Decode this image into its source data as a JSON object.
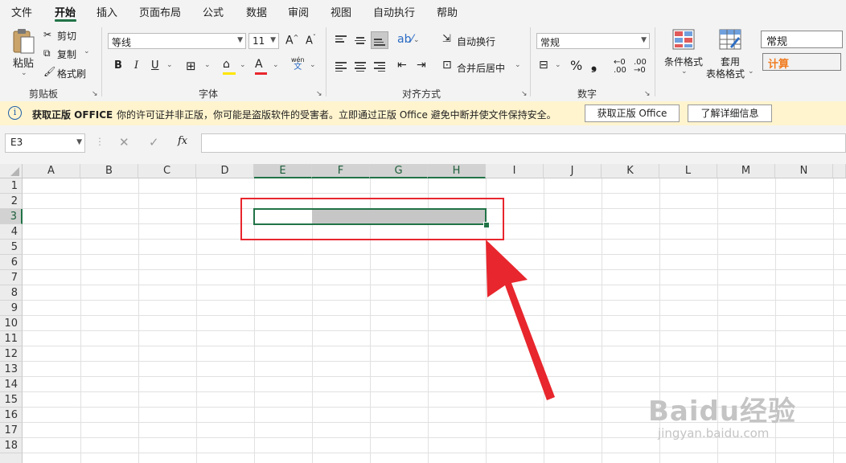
{
  "menu": {
    "items": [
      "文件",
      "开始",
      "插入",
      "页面布局",
      "公式",
      "数据",
      "审阅",
      "视图",
      "自动执行",
      "帮助"
    ],
    "active_index": 1
  },
  "ribbon": {
    "clipboard": {
      "paste": "粘贴",
      "cut": "剪切",
      "copy": "复制",
      "format_painter": "格式刷",
      "label": "剪贴板"
    },
    "font": {
      "name": "等线",
      "size": "11",
      "grow": "A",
      "shrink": "A",
      "bold": "B",
      "italic": "I",
      "underline": "U",
      "font_color_glyph": "A",
      "phonetic_top": "wén",
      "phonetic_bottom": "文",
      "label": "字体"
    },
    "alignment": {
      "wrap_text": "自动换行",
      "merge_center": "合并后居中",
      "label": "对齐方式"
    },
    "number": {
      "format": "常规",
      "percent": "%",
      "comma": "❟",
      "label": "数字"
    },
    "styles": {
      "conditional": "条件格式",
      "table_format_line1": "套用",
      "table_format_line2": "表格格式",
      "style_normal": "常规",
      "style_calc": "计算"
    }
  },
  "notice": {
    "title": "获取正版 OFFICE",
    "message": "你的许可证并非正版，你可能是盗版软件的受害者。立即通过正版 Office 避免中断并使文件保持安全。",
    "btn_get": "获取正版 Office",
    "btn_learn": "了解详细信息"
  },
  "formula_bar": {
    "name_box": "E3",
    "fx": "fx",
    "value": ""
  },
  "grid": {
    "columns": [
      "A",
      "B",
      "C",
      "D",
      "E",
      "F",
      "G",
      "H",
      "I",
      "J",
      "K",
      "L",
      "M",
      "N"
    ],
    "rows": [
      "1",
      "2",
      "3",
      "4",
      "5",
      "6",
      "7",
      "8",
      "9",
      "10",
      "11",
      "12",
      "13",
      "14",
      "15",
      "16",
      "17",
      "18"
    ],
    "active_cell": "E3",
    "selected_range": "E3:H3"
  },
  "watermark": {
    "brand": "Baidu经验",
    "url": "jingyan.baidu.com"
  },
  "colors": {
    "accent": "#217346",
    "annotation": "#e8262d",
    "selection_fill": "#c6c6c6",
    "notice_bg": "#fff4ce",
    "style_calc_text": "#f07b1f"
  }
}
